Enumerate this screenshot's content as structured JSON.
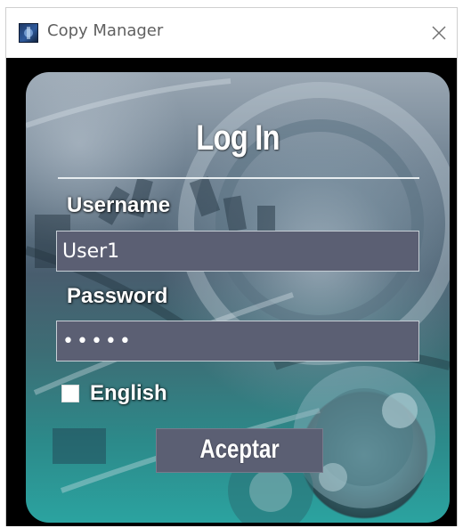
{
  "window": {
    "title": "Copy Manager",
    "icon": "app-icon",
    "close_icon": "close-icon"
  },
  "login": {
    "heading": "Log In",
    "username_label": "Username",
    "username_value": "User1",
    "password_label": "Password",
    "password_value": "•••••",
    "language_checkbox_label": "English",
    "language_checked": false,
    "accept_label": "Aceptar"
  },
  "colors": {
    "client_background": "#000000",
    "input_background": "#5b5f73",
    "teal_bottom": "#2ba3a0",
    "text_white": "#ffffff"
  }
}
